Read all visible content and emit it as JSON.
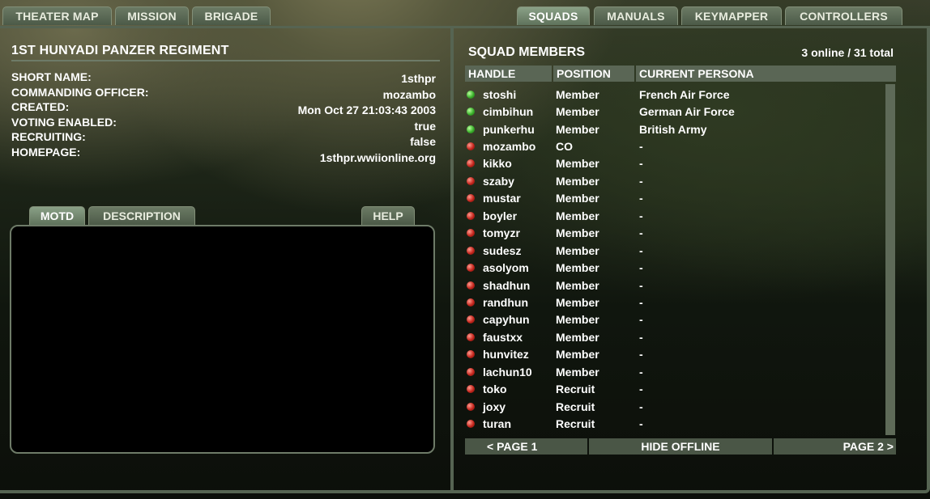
{
  "topnav": {
    "left_tabs": [
      "THEATER MAP",
      "MISSION",
      "BRIGADE"
    ],
    "right_tabs": [
      "SQUADS",
      "MANUALS",
      "KEYMAPPER",
      "CONTROLLERS"
    ],
    "active": "SQUADS"
  },
  "regiment": {
    "title": "1ST HUNYADI PANZER REGIMENT",
    "labels": [
      "SHORT NAME:",
      "COMMANDING OFFICER:",
      "CREATED:",
      "VOTING ENABLED:",
      "RECRUITING:",
      "HOMEPAGE:"
    ],
    "values": [
      "1sthpr",
      "mozambo",
      "Mon Oct 27 21:03:43 2003",
      "true",
      "false",
      "1sthpr.wwiionline.org"
    ]
  },
  "subtabs": {
    "motd": "MOTD",
    "description": "DESCRIPTION",
    "help": "HELP"
  },
  "squad": {
    "title": "SQUAD MEMBERS",
    "count": "3 online / 31 total",
    "columns": [
      "HANDLE",
      "POSITION",
      "CURRENT PERSONA"
    ],
    "members": [
      {
        "handle": "stoshi",
        "position": "Member",
        "persona": "French Air Force",
        "status": "online"
      },
      {
        "handle": "cimbihun",
        "position": "Member",
        "persona": "German Air Force",
        "status": "online"
      },
      {
        "handle": "punkerhu",
        "position": "Member",
        "persona": "British Army",
        "status": "online"
      },
      {
        "handle": "mozambo",
        "position": "CO",
        "persona": "-",
        "status": "offline"
      },
      {
        "handle": "kikko",
        "position": "Member",
        "persona": "-",
        "status": "offline"
      },
      {
        "handle": "szaby",
        "position": "Member",
        "persona": "-",
        "status": "offline"
      },
      {
        "handle": "mustar",
        "position": "Member",
        "persona": "-",
        "status": "offline"
      },
      {
        "handle": "boyler",
        "position": "Member",
        "persona": "-",
        "status": "offline"
      },
      {
        "handle": "tomyzr",
        "position": "Member",
        "persona": "-",
        "status": "offline"
      },
      {
        "handle": "sudesz",
        "position": "Member",
        "persona": "-",
        "status": "offline"
      },
      {
        "handle": "asolyom",
        "position": "Member",
        "persona": "-",
        "status": "offline"
      },
      {
        "handle": "shadhun",
        "position": "Member",
        "persona": "-",
        "status": "offline"
      },
      {
        "handle": "randhun",
        "position": "Member",
        "persona": "-",
        "status": "offline"
      },
      {
        "handle": "capyhun",
        "position": "Member",
        "persona": "-",
        "status": "offline"
      },
      {
        "handle": "faustxx",
        "position": "Member",
        "persona": "-",
        "status": "offline"
      },
      {
        "handle": "hunvitez",
        "position": "Member",
        "persona": "-",
        "status": "offline"
      },
      {
        "handle": "lachun10",
        "position": "Member",
        "persona": "-",
        "status": "offline"
      },
      {
        "handle": "toko",
        "position": "Recruit",
        "persona": "-",
        "status": "offline"
      },
      {
        "handle": "joxy",
        "position": "Recruit",
        "persona": "-",
        "status": "offline"
      },
      {
        "handle": "turan",
        "position": "Recruit",
        "persona": "-",
        "status": "offline"
      }
    ]
  },
  "pager": {
    "prev": "< PAGE 1",
    "toggle": "HIDE OFFLINE",
    "next": "PAGE 2 >"
  }
}
